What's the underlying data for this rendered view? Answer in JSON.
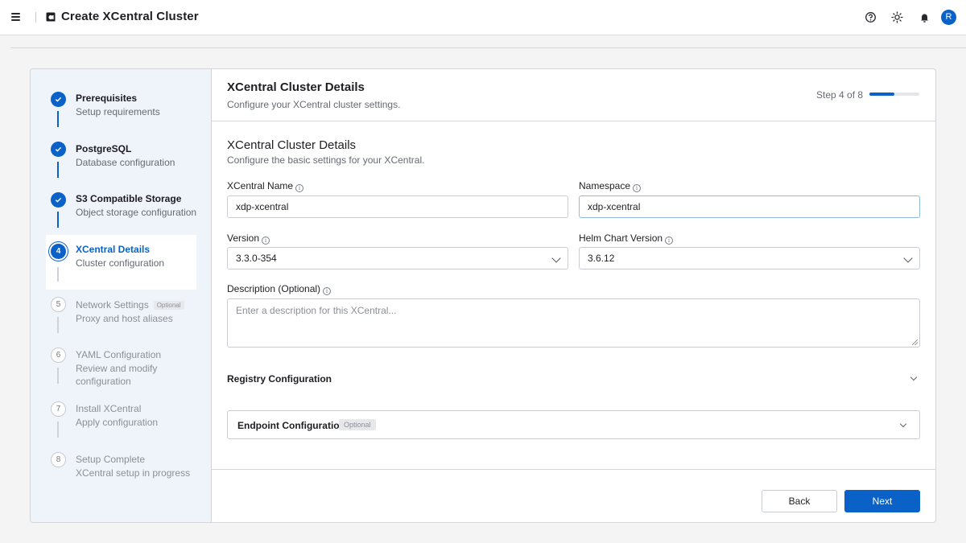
{
  "app": {
    "title": "Create XCentral Cluster",
    "avatar_initial": "R",
    "icons": [
      "menu-icon",
      "app-logo-icon",
      "help-icon",
      "theme-icon",
      "bell-icon"
    ]
  },
  "steps": [
    {
      "number": "1",
      "title": "Prerequisites",
      "desc": "Setup requirements",
      "status": "done"
    },
    {
      "number": "2",
      "title": "PostgreSQL",
      "desc": "Database configuration",
      "status": "done"
    },
    {
      "number": "3",
      "title": "S3 Compatible Storage",
      "desc": "Object storage configuration",
      "status": "done"
    },
    {
      "number": "4",
      "title": "XCentral Details",
      "desc": "Cluster configuration",
      "status": "current"
    },
    {
      "number": "5",
      "title": "Network Settings",
      "tag": "Optional",
      "desc": "Proxy and host aliases",
      "status": "pending"
    },
    {
      "number": "6",
      "title": "YAML Configuration",
      "desc": "Review and modify configuration",
      "status": "pending"
    },
    {
      "number": "7",
      "title": "Install XCentral",
      "desc": "Apply configuration",
      "status": "pending"
    },
    {
      "number": "8",
      "title": "Setup Complete",
      "desc": "XCentral setup in progress",
      "status": "pending"
    }
  ],
  "header": {
    "title": "XCentral Cluster Details",
    "subtitle": "Configure your XCentral cluster settings.",
    "step_count": "Step 4 of 8",
    "progress": 0.5
  },
  "section": {
    "title": "XCentral Cluster Details",
    "subtitle": "Configure the basic settings for your XCentral."
  },
  "form": {
    "name_label": "XCentral Name",
    "name_value": "xdp-xcentral",
    "namespace_label": "Namespace",
    "namespace_value": "xdp-xcentral",
    "version_label": "Version",
    "version_value": "3.3.0-354",
    "helm_label": "Helm Chart Version",
    "helm_value": "3.6.12",
    "description_label": "Description (Optional)",
    "description_placeholder": "Enter a description for this XCentral..."
  },
  "registry": {
    "title": "Registry Configuration",
    "endpoint_label": "Endpoint Configuration",
    "endpoint_tag": "Optional"
  },
  "buttons": {
    "back": "Back",
    "next": "Next"
  },
  "colors": {
    "accent": "#0a62c9",
    "sidebar_bg": "#eff4fb"
  }
}
